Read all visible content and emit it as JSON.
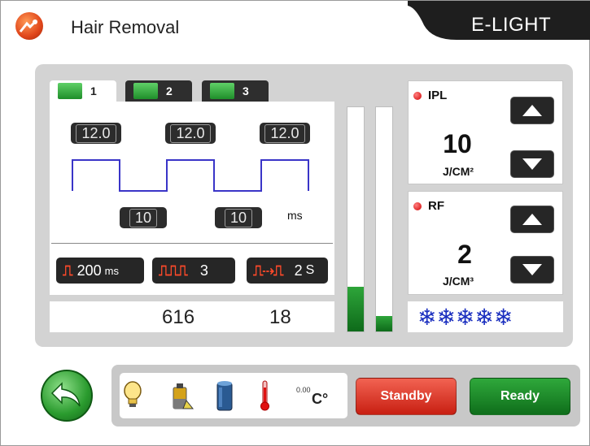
{
  "header": {
    "title": "Hair Removal",
    "brand": "E-LIGHT"
  },
  "tabs": [
    {
      "label": "1",
      "active": true
    },
    {
      "label": "2",
      "active": false
    },
    {
      "label": "3",
      "active": false
    }
  ],
  "pulse": {
    "widths": [
      "12.0",
      "12.0",
      "12.0"
    ],
    "delays": [
      "10",
      "10"
    ],
    "delay_unit": "ms"
  },
  "params": {
    "interval_value": "200",
    "interval_unit": "ms",
    "pulse_count": "3",
    "repeat_value": "2",
    "repeat_unit": "S"
  },
  "counters": {
    "total": "616",
    "session": "18"
  },
  "levels": {
    "bar1": 0.2,
    "bar2": 0.07
  },
  "ipl": {
    "label": "IPL",
    "value": "10",
    "unit": "J/CM²"
  },
  "rf": {
    "label": "RF",
    "value": "2",
    "unit": "J/CM³"
  },
  "cooling": {
    "snowflakes": "❄❄❄❄❄",
    "level": 5
  },
  "status": {
    "temperature": "0.00",
    "temperature_unit": "C°"
  },
  "buttons": {
    "standby": "Standby",
    "ready": "Ready"
  },
  "colors": {
    "wave": "#3a35c8",
    "standby": "#d8301f",
    "ready": "#1c8a2a",
    "snow": "#1b2fbf"
  }
}
